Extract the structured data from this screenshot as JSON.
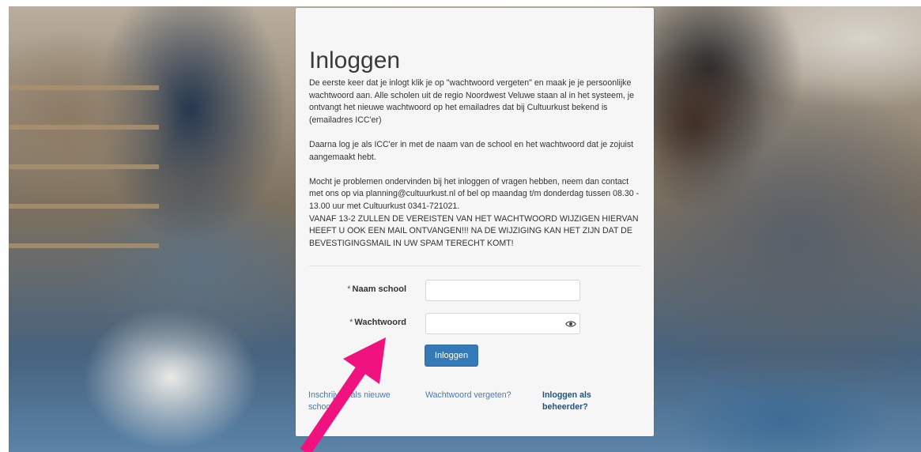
{
  "login": {
    "title": "Inloggen",
    "paragraphs": [
      "De eerste keer dat je inlogt klik je op \"wachtwoord vergeten\" en maak je je persoonlijke wachtwoord aan. Alle scholen uit de regio Noordwest Veluwe staan al in het systeem, je ontvangt het nieuwe wachtwoord op het emailadres dat bij Cultuurkust bekend is (emailadres ICC'er)",
      "Daarna log je als ICC'er in met de naam van de school en het wachtwoord dat je zojuist aangemaakt hebt.",
      "Mocht je problemen ondervinden bij het inloggen of vragen hebben, neem dan contact met ons op via planning@cultuurkust.nl of bel op maandag t/m donderdag tussen 08.30 - 13.00 uur met Cultuurkust 0341-721021.",
      "VANAF 13-2 ZULLEN DE VEREISTEN VAN HET WACHTWOORD WIJZIGEN HIERVAN HEEFT U OOK EEN MAIL ONTVANGEN!!! NA DE WIJZIGING KAN HET ZIJN DAT DE BEVESTIGINGSMAIL IN UW SPAM TERECHT KOMT!"
    ],
    "required_marker": "*",
    "school_label": "Naam school",
    "school_value": "",
    "password_label": "Wachtwoord",
    "password_value": "",
    "submit_label": "Inloggen",
    "links": {
      "register": "Inschrijven als nieuwe school",
      "forgot": "Wachtwoord vergeten?",
      "admin": "Inloggen als beheerder?"
    }
  },
  "icons": {
    "password_toggle": "eye-icon",
    "annotation": "arrow-icon"
  },
  "colors": {
    "primary": "#337ab7",
    "link": "#4a78b4",
    "annotation_arrow": "#f0137f",
    "card": "#f6f6f6"
  }
}
